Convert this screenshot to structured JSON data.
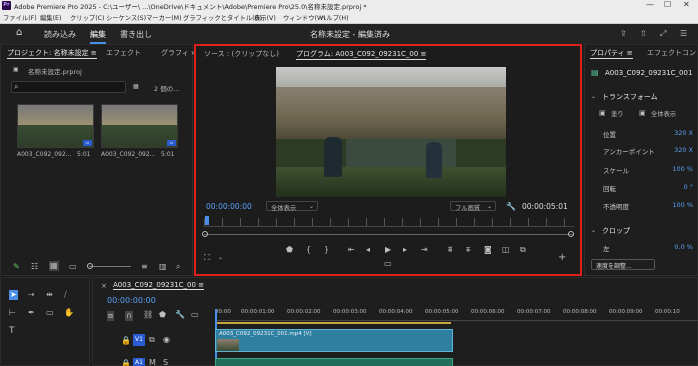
{
  "window": {
    "title": "Adobe Premiere Pro 2025 - C:\\ユーザー\\ ...\\OneDrive\\ドキュメント\\Adobe\\Premiere Pro\\25.0\\名称未設定.prproj *",
    "logo": "Pr",
    "minimize": "—",
    "maximize": "☐",
    "close": "✕"
  },
  "menu": [
    "ファイル(F)",
    "編集(E)",
    "クリップ(C)",
    "シーケンス(S)",
    "マーカー(M)",
    "グラフィックとタイトル(G)",
    "表示(V)",
    "ウィンドウ(W)",
    "ヘルプ(H)"
  ],
  "workspace": {
    "tabs": [
      "読み込み",
      "編集",
      "書き出し"
    ],
    "active_tab": "編集",
    "center_title": "名称未設定 - 編集済み"
  },
  "project_panel": {
    "tabs": [
      "プロジェクト: 名称未設定 ≡",
      "エフェクト",
      "グラフィ »"
    ],
    "file": "名称未設定.prproj",
    "search_placeholder": "",
    "item_count": "2 個の...",
    "items": [
      {
        "name": "A003_C092_092...",
        "duration": "5:01"
      },
      {
        "name": "A003_C092_092...",
        "duration": "5:01"
      }
    ]
  },
  "monitor_panel": {
    "source_tab": "ソース : (クリップなし)",
    "program_tab": "プログラム: A003_C092_09231C_00 ≡",
    "timecode": "00:00:00:00",
    "fit": "全体表示",
    "quality": "フル画質",
    "duration": "00:00:05:01"
  },
  "properties_panel": {
    "tabs": [
      "プロパティ ≡",
      "エフェクトコント"
    ],
    "clip_name": "A003_C092_09231C_001",
    "section_transform": "トランスフォーム",
    "fill_label": "塗り",
    "fit_label": "全体表示",
    "rows": [
      {
        "label": "位置",
        "value": "320 X"
      },
      {
        "label": "アンカーポイント",
        "value": "320 X"
      },
      {
        "label": "スケール",
        "value": "100 %"
      },
      {
        "label": "回転",
        "value": "0 °"
      },
      {
        "label": "不透明度",
        "value": "100 %"
      }
    ],
    "section_crop": "クロップ",
    "crop_left_label": "左",
    "crop_left_value": "0.0 %",
    "speed_button": "速度を調整..."
  },
  "timeline_panel": {
    "sequence_tab": "A003_C092_09231C_00 ≡",
    "timecode": "00:00:00:00",
    "ruler": [
      "00:00",
      "00:00:01:00",
      "00:00:02:00",
      "00:00:03:00",
      "00:00:04:00",
      "00:00:05:00",
      "00:00:06:00",
      "00:00:07:00",
      "00:00:08:00",
      "00:00:09:00",
      "00:00:10"
    ],
    "video_track": "V1",
    "audio_track": "A1",
    "clip_label": "A003_C092_09231C_001.mp4 [V]"
  },
  "colors": {
    "accent": "#4a8fe7",
    "highlight_border": "#e0201b",
    "clip": "#2f7fa0"
  }
}
